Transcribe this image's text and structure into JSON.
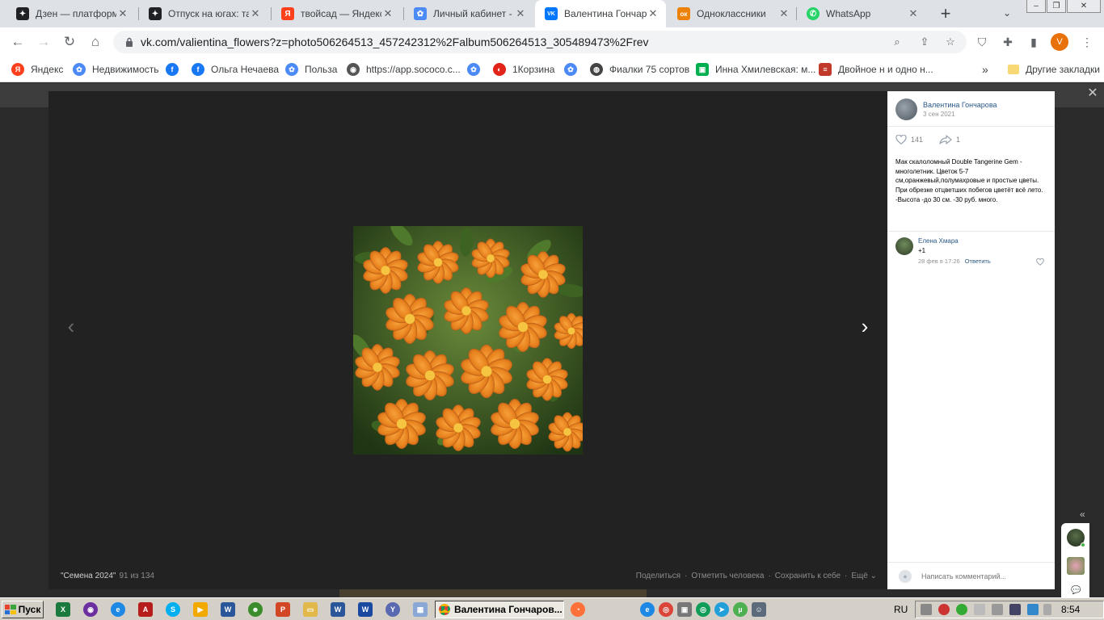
{
  "browser": {
    "tabs": [
      {
        "title": "Дзен — платформа",
        "icon": "dzen-icon",
        "color": "#202124",
        "letter": "✦"
      },
      {
        "title": "Отпуск на югах: та",
        "icon": "dzen-icon",
        "color": "#202124",
        "letter": "✦"
      },
      {
        "title": "твойсад — Яндекс:",
        "icon": "yandex-icon",
        "color": "#fc3f1d",
        "letter": "Я"
      },
      {
        "title": "Личный кабинет - I",
        "icon": "flower-icon",
        "color": "#4c8bf5",
        "letter": "✿"
      },
      {
        "title": "Валентина Гончаро",
        "icon": "vk-icon",
        "color": "#0077ff",
        "letter": "VK",
        "active": true
      },
      {
        "title": "Одноклассники",
        "icon": "ok-icon",
        "color": "#ee8208",
        "letter": "ок"
      },
      {
        "title": "WhatsApp",
        "icon": "whatsapp-icon",
        "color": "#25d366",
        "letter": "✆"
      }
    ],
    "url": "vk.com/valientina_flowers?z=photo506264513_457242312%2Falbum506264513_305489473%2Frev",
    "profile_letter": "V",
    "bookmarks": [
      {
        "label": "Яндекс",
        "color": "#fc3f1d",
        "letter": "Я"
      },
      {
        "label": "Недвижимость",
        "color": "#4c8bf5",
        "letter": "✿"
      },
      {
        "label": "",
        "color": "#1877f2",
        "letter": "f"
      },
      {
        "label": "Ольга Нечаева",
        "color": "#1877f2",
        "letter": "f"
      },
      {
        "label": "Польза",
        "color": "#4c8bf5",
        "letter": "✿"
      },
      {
        "label": "https://app.sococo.c...",
        "color": "#555555",
        "letter": "◉"
      },
      {
        "label": "",
        "color": "#4c8bf5",
        "letter": "✿"
      },
      {
        "label": "1Корзина",
        "color": "#e2231a",
        "letter": "◐"
      },
      {
        "label": "",
        "color": "#4c8bf5",
        "letter": "✿"
      },
      {
        "label": "Фиалки 75 сортов",
        "color": "#444444",
        "letter": "◍"
      },
      {
        "label": "Инна Хмилевская: м...",
        "color": "#00b050",
        "letter": "▣"
      },
      {
        "label": "Двойное н и одно н...",
        "color": "#c0392b",
        "letter": "≡"
      }
    ],
    "bookmarks_overflow": "»",
    "other_bookmarks": "Другие закладки"
  },
  "viewer": {
    "album_name": "\"Семена 2024\"",
    "photo_count": "91 из 134",
    "actions": [
      "Поделиться",
      "Отметить человека",
      "Сохранить к себе",
      "Ещё ⌄"
    ],
    "author": "Валентина Гончарова",
    "date": "3 сен 2021",
    "likes": "141",
    "shares": "1",
    "description": "Мак скалоломный Double Tangerine Gem - многолетник. Цветок 5-7 см,оранжевый,полумахровые и простые цветы. При обрезке отцветших побегов цветёт всё лето. -Высота -до 30 см. -30 руб. много.",
    "comment": {
      "author": "Елена Хмара",
      "text": "+1",
      "time": "28 фев в 17:26",
      "reply": "Ответить"
    },
    "comment_placeholder": "Написать комментарий..."
  },
  "taskbar": {
    "start_label": "Пуск",
    "active_task": "Валентина Гончаров...",
    "language": "RU",
    "clock": "8:54"
  },
  "colors": {
    "vk_link": "#2a5885",
    "flower_orange": "#e8821e",
    "viewer_bg": "#222222"
  }
}
